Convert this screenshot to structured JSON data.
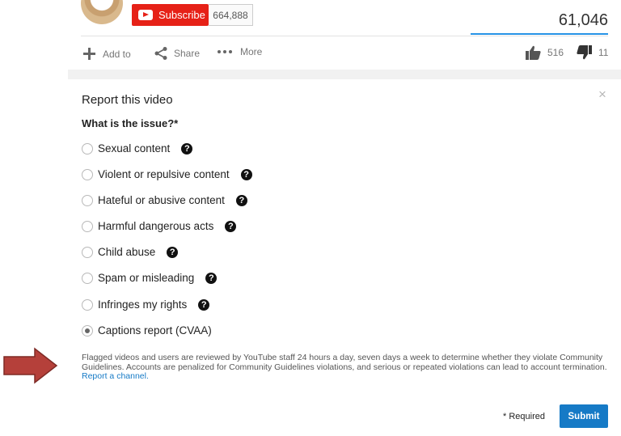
{
  "channel": {
    "subscribe_label": "Subscribe",
    "subscriber_count": "664,888"
  },
  "video": {
    "view_count": "61,046"
  },
  "actions": {
    "add_to": "Add to",
    "share": "Share",
    "more": "More",
    "likes": "516",
    "dislikes": "11"
  },
  "report": {
    "title": "Report this video",
    "question": "What is the issue?*",
    "close": "×",
    "options": [
      {
        "label": "Sexual content",
        "has_help": true,
        "checked": false
      },
      {
        "label": "Violent or repulsive content",
        "has_help": true,
        "checked": false
      },
      {
        "label": "Hateful or abusive content",
        "has_help": true,
        "checked": false
      },
      {
        "label": "Harmful dangerous acts",
        "has_help": true,
        "checked": false
      },
      {
        "label": "Child abuse",
        "has_help": true,
        "checked": false
      },
      {
        "label": "Spam or misleading",
        "has_help": true,
        "checked": false
      },
      {
        "label": "Infringes my rights",
        "has_help": true,
        "checked": false
      },
      {
        "label": "Captions report (CVAA)",
        "has_help": false,
        "checked": true
      }
    ],
    "help_glyph": "?",
    "notice": "Flagged videos and users are reviewed by YouTube staff 24 hours a day, seven days a week to determine whether they violate Community Guidelines. Accounts are penalized for Community Guidelines violations, and serious or repeated violations can lead to account termination.",
    "notice_link": "Report a channel.",
    "required_label": "* Required",
    "submit_label": "Submit"
  },
  "colors": {
    "subscribe_red": "#e62117",
    "link_blue": "#167ac6",
    "arrow_red": "#b5403a"
  }
}
